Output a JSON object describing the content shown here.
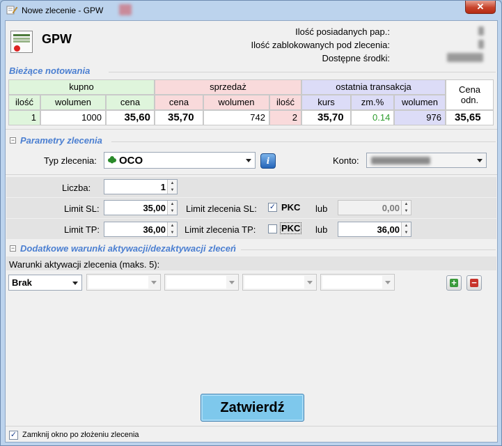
{
  "window": {
    "title": "Nowe zlecenie - GPW",
    "close_label": "✕"
  },
  "header": {
    "app_name": "GPW",
    "owned_label": "Ilość posiadanych pap.:",
    "blocked_label": "Ilość zablokowanych pod zlecenia:",
    "funds_label": "Dostępne środki:"
  },
  "quotes": {
    "section_title": "Bieżące notowania",
    "buy": {
      "title": "kupno",
      "qty_label": "ilość",
      "vol_label": "wolumen",
      "price_label": "cena",
      "qty": "1",
      "vol": "1000",
      "price": "35,60"
    },
    "sell": {
      "title": "sprzedaż",
      "price_label": "cena",
      "vol_label": "wolumen",
      "qty_label": "ilość",
      "price": "35,70",
      "vol": "742",
      "qty": "2"
    },
    "last": {
      "title": "ostatnia transakcja",
      "rate_label": "kurs",
      "change_label": "zm.%",
      "vol_label": "wolumen",
      "rate": "35,70",
      "change": "0.14",
      "vol": "976"
    },
    "ref": {
      "label_line1": "Cena",
      "label_line2": "odn.",
      "value": "35,65"
    }
  },
  "params": {
    "section_title": "Parametry zlecenia",
    "order_type_label": "Typ zlecenia:",
    "order_type_value": "OCO",
    "account_label": "Konto:",
    "count_label": "Liczba:",
    "count_value": "1",
    "limit_sl_label": "Limit SL:",
    "limit_sl_value": "35,00",
    "limit_order_sl_label": "Limit zlecenia SL:",
    "pkc_label": "PKC",
    "or_label": "lub",
    "sl_alt_value": "0,00",
    "limit_tp_label": "Limit TP:",
    "limit_tp_value": "36,00",
    "limit_order_tp_label": "Limit zlecenia TP:",
    "tp_alt_value": "36,00",
    "info_label": "i"
  },
  "conditions": {
    "section_title": "Dodatkowe warunki aktywacji/dezaktywacji zleceń",
    "subtitle": "Warunki aktywacji zlecenia (maks. 5):",
    "first_value": "Brak",
    "add_label": "+",
    "remove_label": "−"
  },
  "footer": {
    "submit_label": "Zatwierdź",
    "close_checkbox_label": "Zamknij okno po złożeniu zlecenia"
  },
  "colors": {
    "accent": "#4b7fd1",
    "change_up": "#2e9d2e",
    "submit_bg": "#7ec8ec"
  }
}
